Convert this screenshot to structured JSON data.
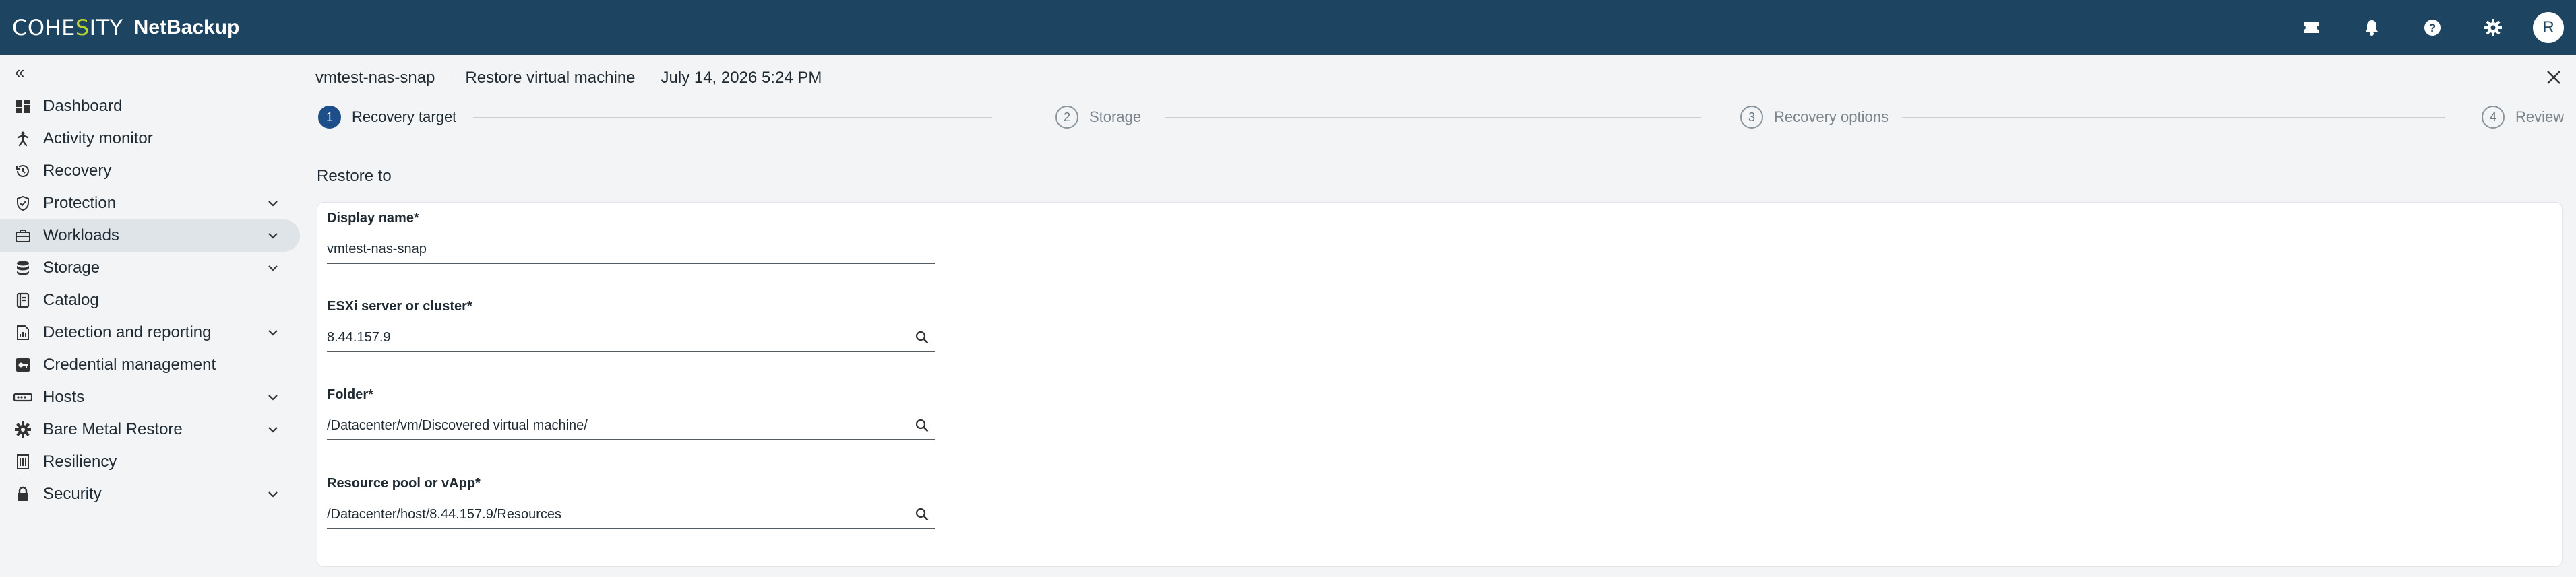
{
  "brand": {
    "logo_pre": "COHE",
    "logo_s": "S",
    "logo_post": "ITY",
    "product": "NetBackup"
  },
  "topbar": {
    "avatar_initial": "R",
    "icons": [
      "ticket-icon",
      "bell-icon",
      "help-icon",
      "gear-icon"
    ]
  },
  "sidebar": {
    "collapse_glyph": "«",
    "items": [
      {
        "label": "Dashboard",
        "icon": "dashboard-icon",
        "expandable": false
      },
      {
        "label": "Activity monitor",
        "icon": "activity-icon",
        "expandable": false
      },
      {
        "label": "Recovery",
        "icon": "history-icon",
        "expandable": false
      },
      {
        "label": "Protection",
        "icon": "shield-icon",
        "expandable": true
      },
      {
        "label": "Workloads",
        "icon": "briefcase-icon",
        "expandable": true,
        "active": true
      },
      {
        "label": "Storage",
        "icon": "database-icon",
        "expandable": true
      },
      {
        "label": "Catalog",
        "icon": "book-icon",
        "expandable": false
      },
      {
        "label": "Detection and reporting",
        "icon": "report-icon",
        "expandable": true
      },
      {
        "label": "Credential management",
        "icon": "key-icon",
        "expandable": false
      },
      {
        "label": "Hosts",
        "icon": "server-icon",
        "expandable": true
      },
      {
        "label": "Bare Metal Restore",
        "icon": "gear-cluster-icon",
        "expandable": true
      },
      {
        "label": "Resiliency",
        "icon": "building-icon",
        "expandable": false
      },
      {
        "label": "Security",
        "icon": "lock-icon",
        "expandable": true
      }
    ]
  },
  "header": {
    "asset_name": "vmtest-nas-snap",
    "title": "Restore virtual machine",
    "date": "July 14, 2026 5:24 PM"
  },
  "stepper": [
    {
      "number": "1",
      "label": "Recovery target",
      "state": "active"
    },
    {
      "number": "2",
      "label": "Storage",
      "state": "pending"
    },
    {
      "number": "3",
      "label": "Recovery options",
      "state": "pending"
    },
    {
      "number": "4",
      "label": "Review",
      "state": "pending"
    }
  ],
  "form": {
    "section_title": "Restore to",
    "display_name": {
      "label": "Display name*",
      "value": "vmtest-nas-snap"
    },
    "esxi": {
      "label": "ESXi server or cluster*",
      "value": "8.44.157.9"
    },
    "folder": {
      "label": "Folder*",
      "value": "/Datacenter/vm/Discovered virtual machine/"
    },
    "resource_pool": {
      "label": "Resource pool or vApp*",
      "value": "/Datacenter/host/8.44.157.9/Resources"
    }
  },
  "colors": {
    "topbar": "#1d4460",
    "accent": "#1d4e89",
    "logo_accent": "#b8d431"
  }
}
